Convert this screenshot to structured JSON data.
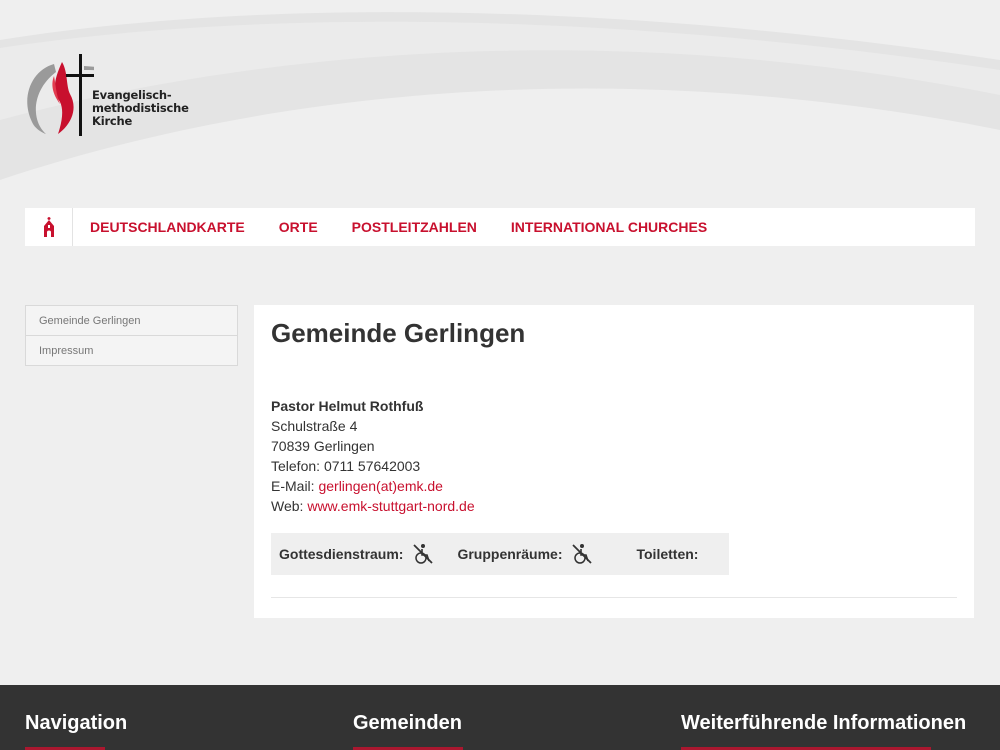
{
  "logo": {
    "line1": "Evangelisch-",
    "line2": "methodistische",
    "line3": "Kirche"
  },
  "nav": {
    "home_icon": "church-icon",
    "items": [
      "DEUTSCHLANDKARTE",
      "ORTE",
      "POSTLEITZAHLEN",
      "INTERNATIONAL CHURCHES"
    ]
  },
  "sidebar": {
    "items": [
      "Gemeinde Gerlingen",
      "Impressum"
    ]
  },
  "content": {
    "title": "Gemeinde Gerlingen",
    "pastor": "Pastor Helmut Rothfuß",
    "street": "Schulstraße 4",
    "city": "70839 Gerlingen",
    "phone_label": "Telefon:",
    "phone": "0711 57642003",
    "email_label": "E-Mail:",
    "email": "gerlingen(at)emk.de",
    "web_label": "Web:",
    "web": "www.emk-stuttgart-nord.de",
    "features": {
      "worship_label": "Gottesdienstraum:",
      "groups_label": "Gruppenräume:",
      "toilets_label": "Toiletten:",
      "icon": "no-wheelchair-icon"
    }
  },
  "footer": {
    "col1": "Navigation",
    "col2": "Gemeinden",
    "col3": "Weiterführende Informationen"
  },
  "colors": {
    "accent": "#c8102e",
    "background": "#efefef",
    "footer": "#333333"
  }
}
